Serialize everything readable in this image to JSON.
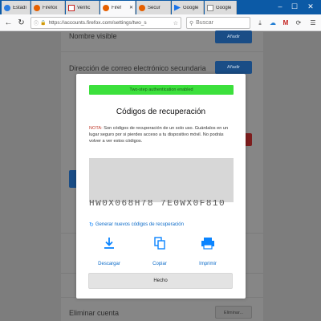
{
  "browser": {
    "tabs": [
      {
        "title": "Estadí",
        "color": "#2a7de1"
      },
      {
        "title": "Firefox",
        "color": "#e66000"
      },
      {
        "title": "Verific",
        "color": "#c5221f"
      },
      {
        "title": "Firef",
        "color": "#e66000"
      },
      {
        "title": "Secur",
        "color": "#e66000"
      },
      {
        "title": "Google",
        "color": "#1a73e8"
      },
      {
        "title": "Google",
        "color": "#bdbdbd"
      }
    ],
    "url_text": "https://accounts.firefox.com/settings/two_s",
    "search_placeholder": "Buscar"
  },
  "background": {
    "row_display_name": "Nombre visible",
    "row_secondary_email": "Dirección de correo electrónico secundaria",
    "row_delete_account": "Eliminar cuenta",
    "btn_add": "Añadir",
    "btn_delete": "Eliminar..."
  },
  "modal": {
    "banner_text": "Two-step authentication enabled",
    "title": "Códigos de recuperación",
    "note_label": "NOTA:",
    "note_text": " Son códigos de recuperación de un solo uso. Guárdalos en un lugar seguro por si pierdes acceso a tu dispositivo móvil. No podrás volver a ver estos códigos.",
    "visible_code_fragment": "HW0X068H78 7E0WX0F810",
    "regenerate_label": "Generar nuevos códigos de recuperación",
    "actions": [
      {
        "label": "Descargar",
        "icon": "download-icon"
      },
      {
        "label": "Copiar",
        "icon": "copy-icon"
      },
      {
        "label": "Imprimir",
        "icon": "print-icon"
      }
    ],
    "done_label": "Hecho"
  },
  "colors": {
    "accent": "#0a84ff",
    "banner": "#3ce03c",
    "tabbar": "#0c5aa6"
  }
}
